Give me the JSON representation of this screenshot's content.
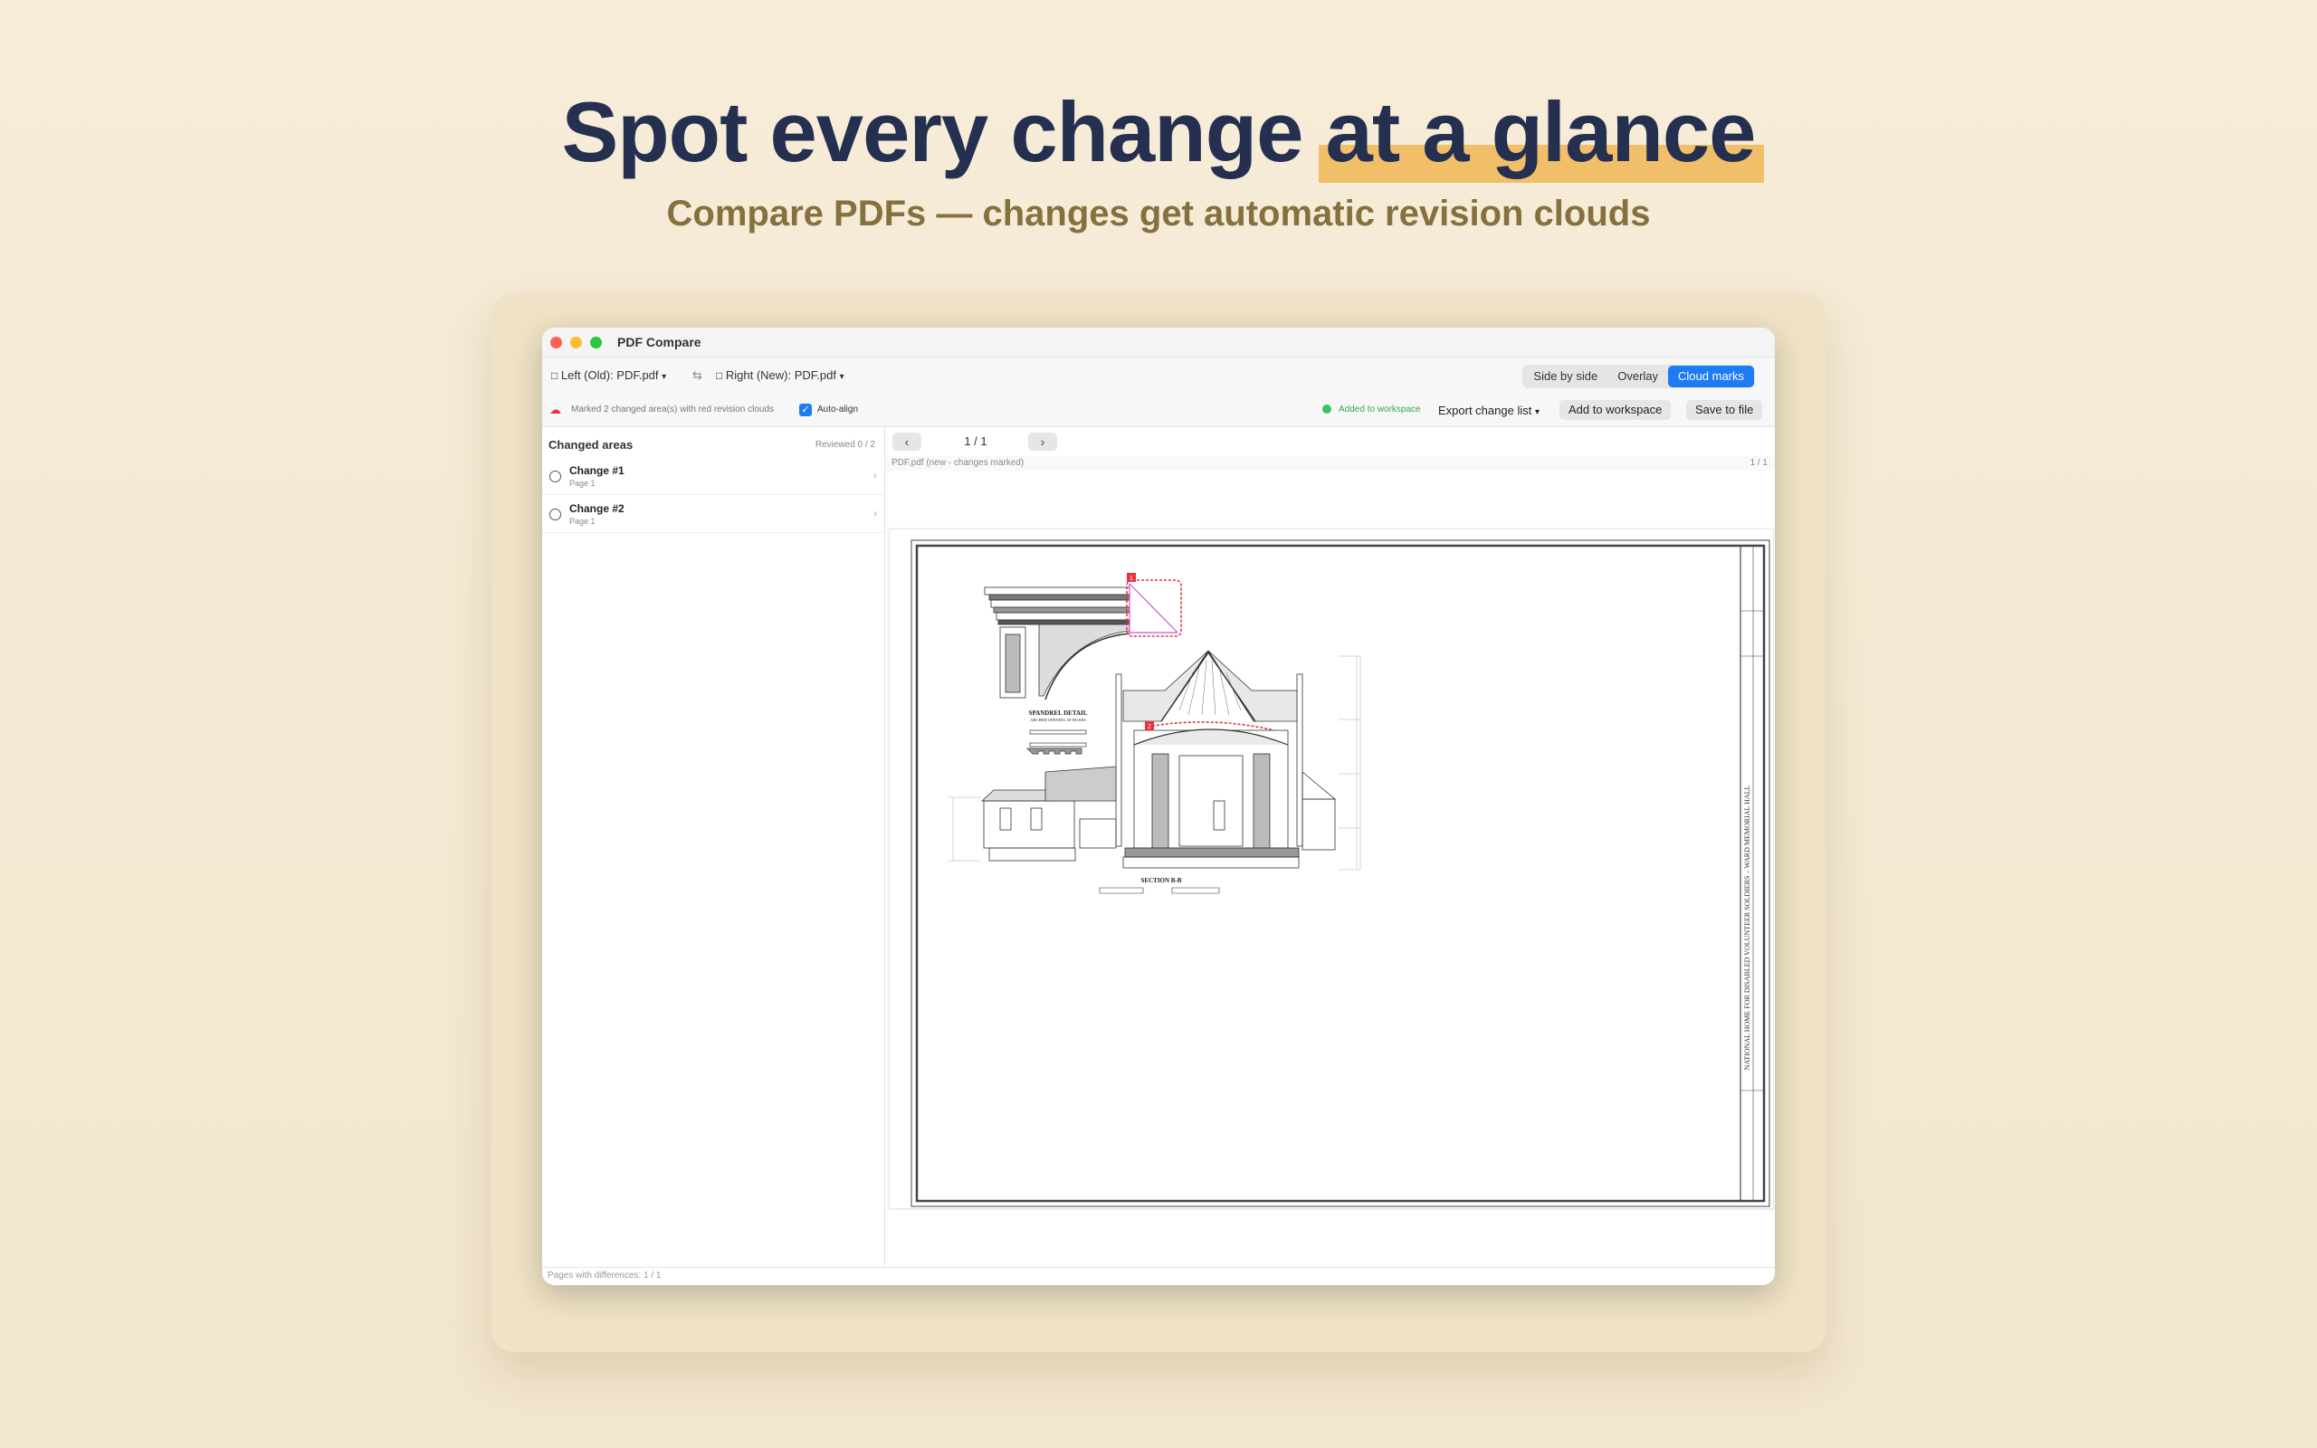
{
  "hero": {
    "title_main": "Spot every change",
    "title_highlight": "at a glance",
    "subtitle": "Compare PDFs — changes get automatic revision clouds"
  },
  "window": {
    "title": "PDF Compare",
    "left_file": "Left (Old): PDF.pdf",
    "right_file": "Right (New): PDF.pdf",
    "view_modes": [
      "Side by side",
      "Overlay",
      "Cloud marks"
    ],
    "active_view": "Cloud marks"
  },
  "status": {
    "message": "Marked 2 changed area(s) with red revision clouds",
    "auto_align_label": "Auto-align",
    "auto_align_checked": true,
    "workspace_status": "Added to workspace",
    "export_label": "Export change list",
    "add_workspace_label": "Add to workspace",
    "save_label": "Save to file"
  },
  "sidebar": {
    "header": "Changed areas",
    "reviewed": "Reviewed 0 / 2",
    "items": [
      {
        "title": "Change #1",
        "page": "Page 1"
      },
      {
        "title": "Change #2",
        "page": "Page 1"
      }
    ]
  },
  "viewer": {
    "page_indicator": "1 / 1",
    "doc_label": "PDF.pdf (new - changes marked)",
    "doc_pages": "1 / 1",
    "drawing": {
      "spandrel_title": "SPANDREL DETAIL",
      "spandrel_sub": "ARCHED OPENING AT BOXES",
      "section_title": "SECTION B-B",
      "sheet_title": "NATIONAL HOME FOR DISABLED VOLUNTEER SOLDIERS – WARD MEMORIAL HALL",
      "marker_1": "1",
      "marker_2": "2"
    }
  },
  "footer": {
    "text": "Pages with differences: 1 / 1"
  },
  "colors": {
    "accent": "#1d7cf2",
    "headline": "#253050",
    "highlight": "#f1bf6a",
    "subtitle": "#86703e",
    "cloud": "#e8323c",
    "change_box": "#d14fd6"
  }
}
